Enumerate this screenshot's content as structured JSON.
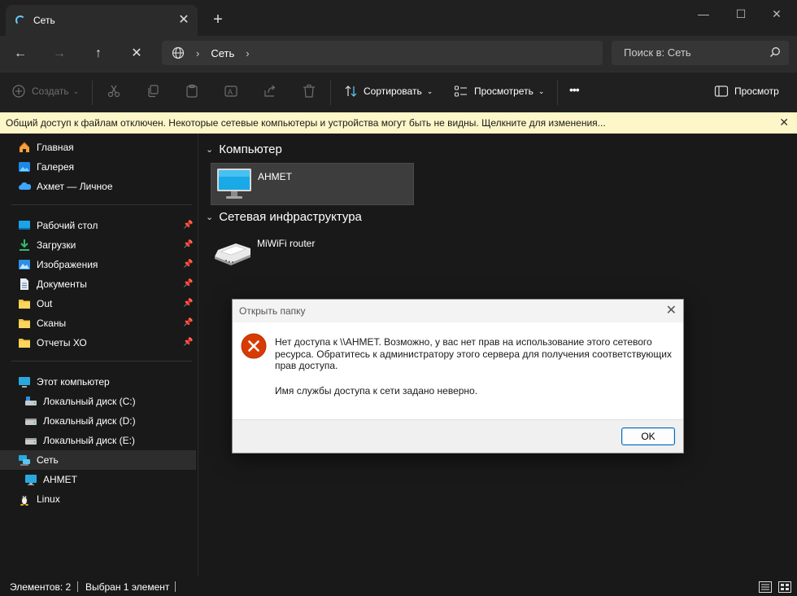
{
  "window": {
    "tab_title": "Сеть",
    "tab_close": "✕",
    "new_tab": "+",
    "minimize": "—",
    "maximize": "☐",
    "close": "✕"
  },
  "nav": {
    "back": "←",
    "forward": "→",
    "up": "↑",
    "stop": "✕",
    "breadcrumb": [
      "Сеть"
    ],
    "search_placeholder": "Поиск в: Сеть"
  },
  "commands": {
    "create": "Создать",
    "sort": "Сортировать",
    "view": "Просмотреть",
    "more": "•••",
    "preview": "Просмотр"
  },
  "infobar": {
    "message": "Общий доступ к файлам отключен. Некоторые сетевые компьютеры и устройства могут быть не видны. Щелкните для изменения...",
    "close": "✕"
  },
  "sidebar": {
    "items": [
      {
        "label": "Главная",
        "icon": "home-icon"
      },
      {
        "label": "Галерея",
        "icon": "gallery-icon"
      },
      {
        "label": "Ахмет — Личное",
        "icon": "onedrive-icon"
      },
      {
        "label": "Рабочий стол",
        "icon": "desktop-icon",
        "pinned": true
      },
      {
        "label": "Загрузки",
        "icon": "downloads-icon",
        "pinned": true
      },
      {
        "label": "Изображения",
        "icon": "pictures-icon",
        "pinned": true
      },
      {
        "label": "Документы",
        "icon": "documents-icon",
        "pinned": true
      },
      {
        "label": "Out",
        "icon": "folder-icon",
        "pinned": true
      },
      {
        "label": "Сканы",
        "icon": "folder-icon",
        "pinned": true
      },
      {
        "label": "Отчеты ХО",
        "icon": "folder-icon",
        "pinned": true
      },
      {
        "label": "Этот компьютер",
        "icon": "this-pc-icon"
      },
      {
        "label": "Локальный диск (C:)",
        "icon": "drive-icon"
      },
      {
        "label": "Локальный диск (D:)",
        "icon": "drive-icon"
      },
      {
        "label": "Локальный диск (E:)",
        "icon": "drive-icon"
      },
      {
        "label": "Сеть",
        "icon": "network-icon",
        "selected": true
      },
      {
        "label": "AHMET",
        "icon": "computer-icon"
      },
      {
        "label": "Linux",
        "icon": "linux-icon"
      }
    ]
  },
  "content": {
    "groups": [
      {
        "title": "Компьютер",
        "items": [
          {
            "name": "AHMET",
            "icon": "computer-icon",
            "selected": true
          }
        ]
      },
      {
        "title": "Сетевая инфраструктура",
        "items": [
          {
            "name": "MiWiFi router",
            "icon": "router-icon"
          }
        ]
      }
    ]
  },
  "statusbar": {
    "count": "Элементов: 2",
    "selected": "Выбран 1 элемент"
  },
  "dialog": {
    "title": "Открыть папку",
    "close": "✕",
    "message": "Нет доступа к \\\\AHMET. Возможно, у вас нет прав на использование этого сетевого ресурса. Обратитесь к администратору этого сервера для получения соответствующих прав доступа.",
    "detail": "Имя службы доступа к сети задано неверно.",
    "ok": "OK"
  },
  "colors": {
    "accent": "#60cdff",
    "infobar_bg": "#fdf6c8",
    "error_red": "#d83b01"
  }
}
